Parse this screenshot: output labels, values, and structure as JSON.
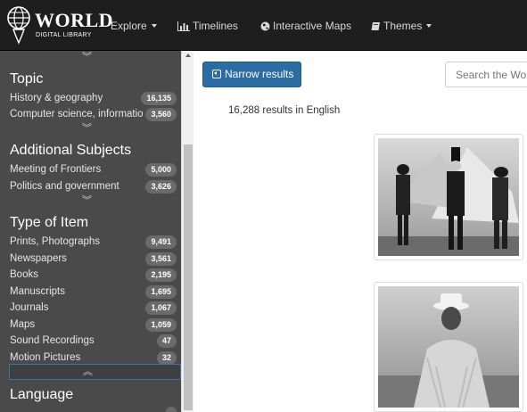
{
  "nav": {
    "logo_title": "WORLD",
    "logo_sub": "DIGITAL LIBRARY",
    "items": [
      {
        "label": "Explore",
        "has_caret": true
      },
      {
        "label": "Timelines",
        "icon": "bar-chart-icon"
      },
      {
        "label": "Interactive Maps",
        "icon": "globe-icon"
      },
      {
        "label": "Themes",
        "icon": "book-icon",
        "has_caret": true
      }
    ]
  },
  "sidebar": {
    "topic": {
      "title": "Topic",
      "items": [
        {
          "label": "History & geography",
          "count": "16,135"
        },
        {
          "label": "Computer science, information",
          "count": "3,560"
        }
      ]
    },
    "additional": {
      "title": "Additional Subjects",
      "items": [
        {
          "label": "Meeting of Frontiers",
          "count": "5,000"
        },
        {
          "label": "Politics and government",
          "count": "3,626"
        }
      ]
    },
    "type": {
      "title": "Type of Item",
      "items": [
        {
          "label": "Prints, Photographs",
          "count": "9,491"
        },
        {
          "label": "Newspapers",
          "count": "3,561"
        },
        {
          "label": "Books",
          "count": "2,195"
        },
        {
          "label": "Manuscripts",
          "count": "1,695"
        },
        {
          "label": "Journals",
          "count": "1,067"
        },
        {
          "label": "Maps",
          "count": "1,059"
        },
        {
          "label": "Sound Recordings",
          "count": "47"
        },
        {
          "label": "Motion Pictures",
          "count": "32"
        }
      ]
    },
    "language": {
      "title": "Language"
    }
  },
  "main": {
    "narrow_label": "Narrow results",
    "search_placeholder": "Search the Wor",
    "results_text": "16,288 results in English"
  },
  "colors": {
    "nav_bg": "#1e1e1e",
    "sidebar_bg": "#4a4a4a",
    "button_primary": "#2d6ca2"
  }
}
